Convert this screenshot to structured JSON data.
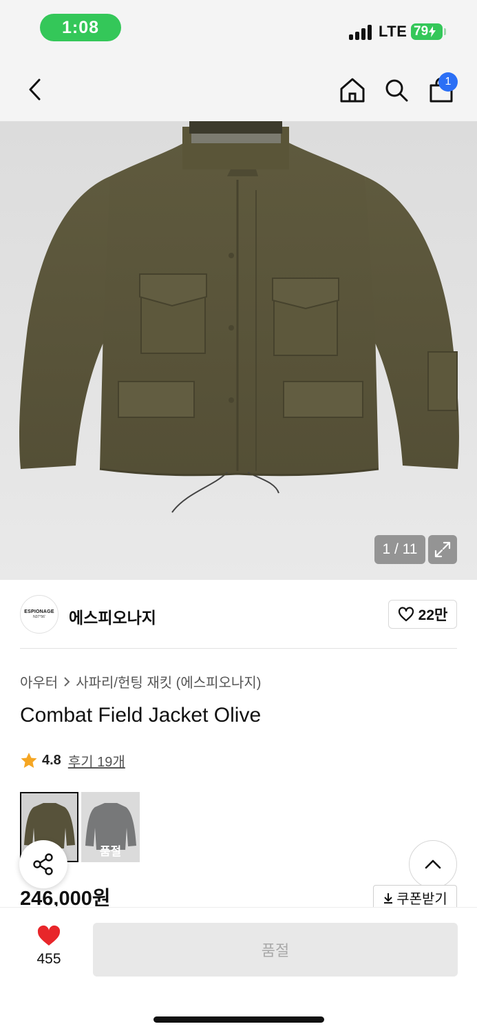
{
  "status_bar": {
    "time": "1:08",
    "network": "LTE",
    "battery": "79"
  },
  "nav": {
    "cart_count": "1"
  },
  "gallery": {
    "counter": "1 / 11"
  },
  "brand": {
    "logo_line1": "ESPIONAGE",
    "logo_line2": "N37°56'",
    "name": "에스피오나지",
    "likes": "22만"
  },
  "breadcrumb": {
    "category": "아우터",
    "subcategory": "사파리/헌팅 재킷 (에스피오나지)"
  },
  "product": {
    "title": "Combat Field Jacket Olive",
    "rating": "4.8",
    "reviews": "후기 19개",
    "price": "246,000원",
    "coupon": "쿠폰받기",
    "variant_soldout_label": "품절"
  },
  "bottom": {
    "wish_count": "455",
    "buy_label": "품절"
  },
  "colors": {
    "accent_green": "#34c759",
    "badge_blue": "#2b6ff5",
    "heart_red": "#e8262a",
    "star": "#f5a623",
    "jacket_olive": "#5a5539"
  }
}
